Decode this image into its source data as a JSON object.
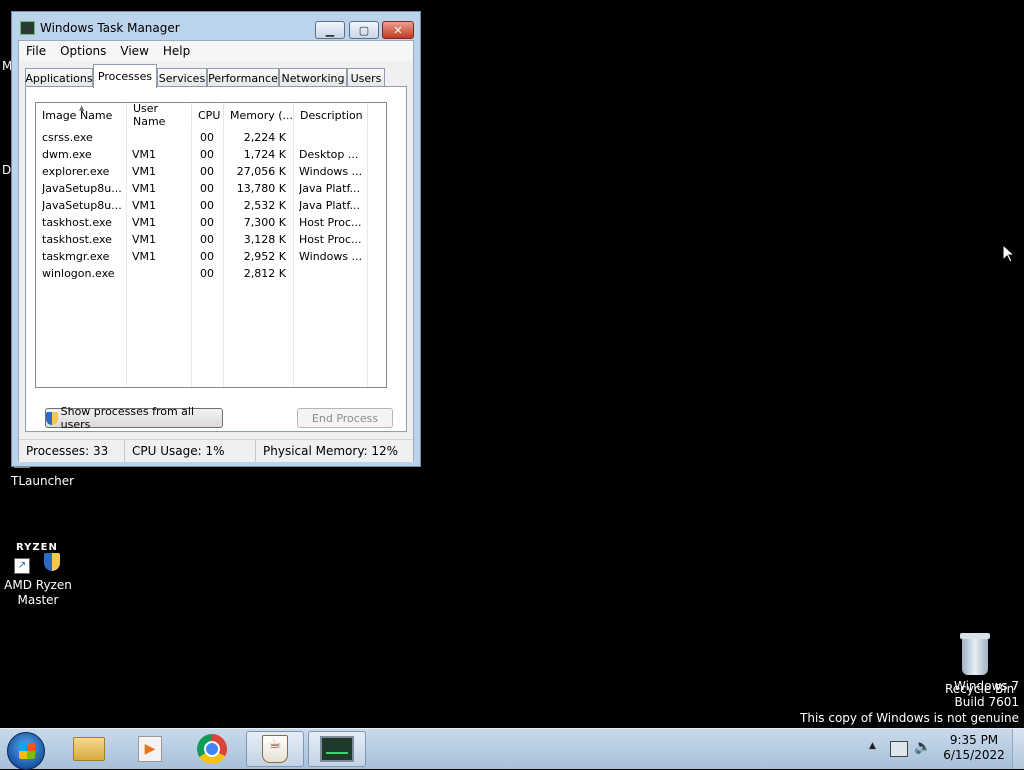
{
  "desktop": {
    "partial_labels": [
      "M",
      "D"
    ],
    "tlauncher_label": "TLauncher",
    "ryzen_icon_text": "RYZEN",
    "ryzen_label_line1": "AMD Ryzen",
    "ryzen_label_line2": "Master",
    "recycle_bin_label": "Recycle Bin",
    "watermark": {
      "line1": "Windows 7",
      "line2": "Build 7601",
      "line3": "This copy of Windows is not genuine"
    }
  },
  "window": {
    "title": "Windows Task Manager",
    "minimize_glyph": "▁",
    "maximize_glyph": "▢",
    "close_glyph": "✕",
    "menu": [
      "File",
      "Options",
      "View",
      "Help"
    ],
    "tabs": [
      "Applications",
      "Processes",
      "Services",
      "Performance",
      "Networking",
      "Users"
    ],
    "active_tab": "Processes",
    "columns": [
      "Image Name",
      "User Name",
      "CPU",
      "Memory (...",
      "Description"
    ],
    "sort_indicator": "▲",
    "rows": [
      {
        "image": "csrss.exe",
        "user": "",
        "cpu": "00",
        "memory": "2,224 K",
        "desc": ""
      },
      {
        "image": "dwm.exe",
        "user": "VM1",
        "cpu": "00",
        "memory": "1,724 K",
        "desc": "Desktop ..."
      },
      {
        "image": "explorer.exe",
        "user": "VM1",
        "cpu": "00",
        "memory": "27,056 K",
        "desc": "Windows ..."
      },
      {
        "image": "JavaSetup8u...",
        "user": "VM1",
        "cpu": "00",
        "memory": "13,780 K",
        "desc": "Java Platf..."
      },
      {
        "image": "JavaSetup8u...",
        "user": "VM1",
        "cpu": "00",
        "memory": "2,532 K",
        "desc": "Java Platf..."
      },
      {
        "image": "taskhost.exe",
        "user": "VM1",
        "cpu": "00",
        "memory": "7,300 K",
        "desc": "Host Proc..."
      },
      {
        "image": "taskhost.exe",
        "user": "VM1",
        "cpu": "00",
        "memory": "3,128 K",
        "desc": "Host Proc..."
      },
      {
        "image": "taskmgr.exe",
        "user": "VM1",
        "cpu": "00",
        "memory": "2,952 K",
        "desc": "Windows ..."
      },
      {
        "image": "winlogon.exe",
        "user": "",
        "cpu": "00",
        "memory": "2,812 K",
        "desc": ""
      }
    ],
    "show_all_button": "Show processes from all users",
    "end_process_button": "End Process",
    "status": {
      "processes": "Processes: 33",
      "cpu": "CPU Usage: 1%",
      "memory": "Physical Memory: 12%"
    }
  },
  "taskbar": {
    "pinned": [
      "windows-explorer",
      "media-player",
      "chrome",
      "java",
      "task-manager"
    ],
    "tray_arrow": "▲",
    "time": "9:35 PM",
    "date": "6/15/2022"
  },
  "colors": {
    "desktop": "#000000",
    "window_frame": "#bcd3ec",
    "taskbar": "#b7cbe1",
    "close_button": "#c23a22"
  }
}
